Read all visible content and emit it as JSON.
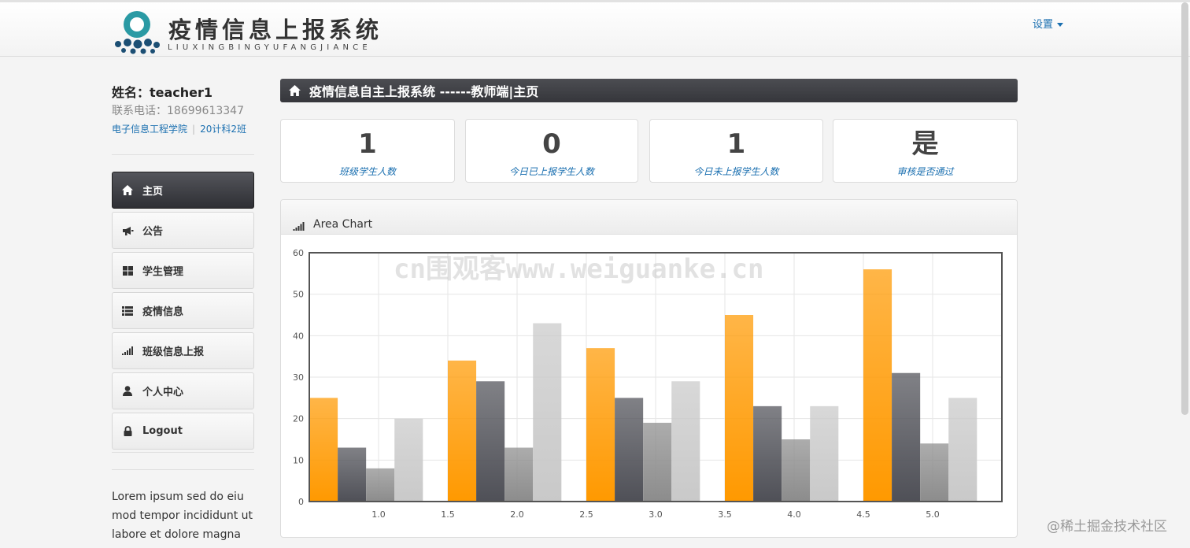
{
  "header": {
    "logo_title": "疫情信息上报系统",
    "logo_subtitle": "LIUXINGBINGYUFANGJIANCE",
    "settings_label": "设置"
  },
  "user": {
    "name": "姓名：teacher1",
    "phone": "联系电话：18699613347",
    "college": "电子信息工程学院",
    "class": "20计科2班"
  },
  "nav": {
    "items": [
      {
        "label": "主页",
        "icon": "home-icon"
      },
      {
        "label": "公告",
        "icon": "megaphone-icon"
      },
      {
        "label": "学生管理",
        "icon": "grid-icon"
      },
      {
        "label": "疫情信息",
        "icon": "list-icon"
      },
      {
        "label": "班级信息上报",
        "icon": "signal-icon"
      },
      {
        "label": "个人中心",
        "icon": "user-icon"
      },
      {
        "label": "Logout",
        "icon": "lock-icon"
      }
    ]
  },
  "sidebar_text": "Lorem ipsum sed do eiu mod tempor incididunt ut labore et dolore magna",
  "page": {
    "title": "疫情信息自主上报系统 ------教师端|主页"
  },
  "stats": [
    {
      "value": "1",
      "label": "班级学生人数"
    },
    {
      "value": "0",
      "label": "今日已上报学生人数"
    },
    {
      "value": "1",
      "label": "今日未上报学生人数"
    },
    {
      "value": "是",
      "label": "审核是否通过"
    }
  ],
  "chart_panel": {
    "title": "Area Chart"
  },
  "chart_data": {
    "type": "bar",
    "x": [
      1,
      2,
      3,
      4,
      5
    ],
    "xticks": [
      "1.0",
      "1.5",
      "2.0",
      "2.5",
      "3.0",
      "3.5",
      "4.0",
      "4.5",
      "5.0"
    ],
    "xlim": [
      0.5,
      5.5
    ],
    "ylim": [
      0,
      60
    ],
    "yticks": [
      "0",
      "10",
      "20",
      "30",
      "40",
      "50",
      "60"
    ],
    "grid": true,
    "series": [
      {
        "color": "#ff9900",
        "values": [
          25,
          34,
          37,
          45,
          56
        ]
      },
      {
        "color": "#4f5057",
        "values": [
          13,
          29,
          25,
          23,
          31
        ]
      },
      {
        "color": "#8c8c8c",
        "values": [
          8,
          13,
          19,
          15,
          14
        ]
      },
      {
        "color": "#c9c9c9",
        "values": [
          20,
          43,
          29,
          23,
          25
        ]
      }
    ]
  },
  "watermark": "cn围观客www.weiguanke.cn",
  "footer_mark": "@稀土掘金技术社区",
  "colors": {
    "accent": "#1a6fb0",
    "dark_bar": "#35363b"
  }
}
